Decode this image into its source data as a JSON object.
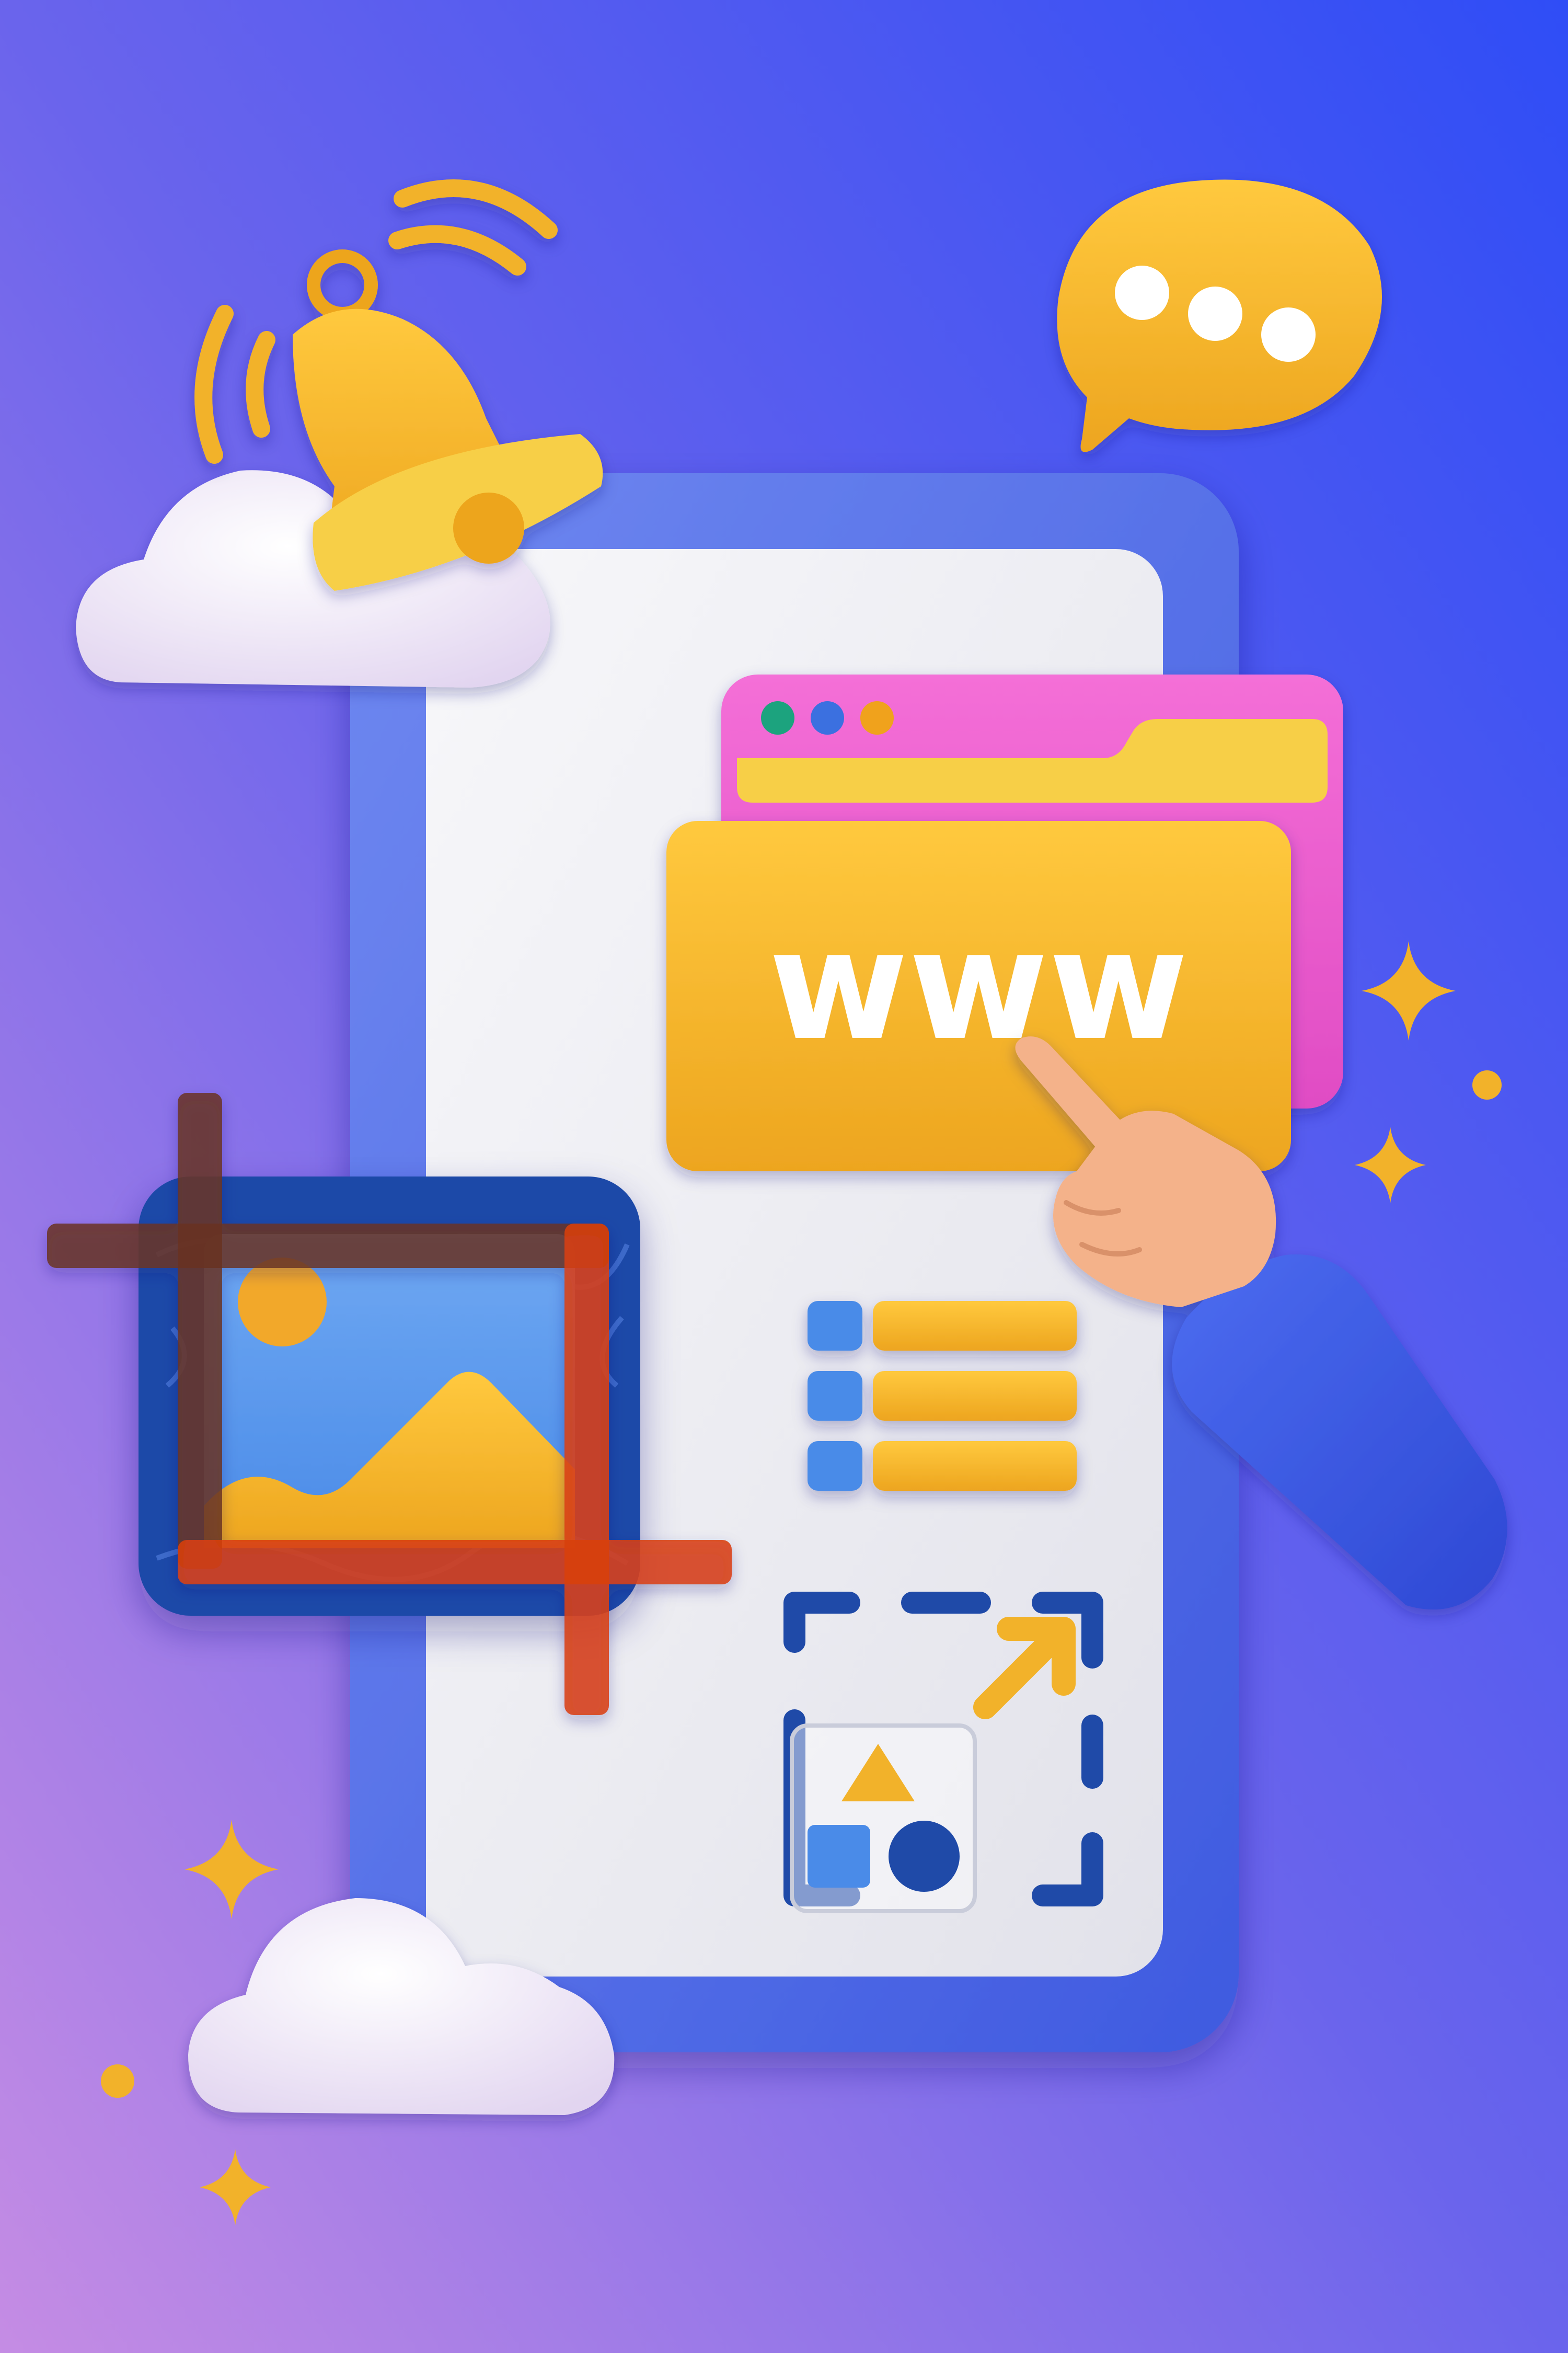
{
  "browser_window": {
    "url_text": "www"
  },
  "colors": {
    "background_top_right": "#3350F5",
    "background_bottom_left": "#C488E3",
    "phone_frame": "#4766E5",
    "phone_screen": "#EEEEF2",
    "accent_yellow": "#F2B22A",
    "accent_pink": "#EE5ACD",
    "icon_blue": "#4A8BE8",
    "crop_red": "#D8400F",
    "crop_brown": "#6A3420",
    "cloud_white": "#F1E9F6",
    "dot_green": "#1FA37E",
    "dot_blue": "#3B6FE0",
    "dot_orange": "#F0A21C",
    "skin": "#F4B28A",
    "sleeve_blue": "#3858E0"
  },
  "icons": [
    "bell-icon",
    "chat-bubble-icon",
    "cloud-icon",
    "browser-window-icon",
    "folder-icon",
    "pointing-hand-icon",
    "list-icon",
    "image-icon",
    "crop-icon",
    "resize-icon",
    "shapes-icon",
    "sparkle-icon"
  ]
}
